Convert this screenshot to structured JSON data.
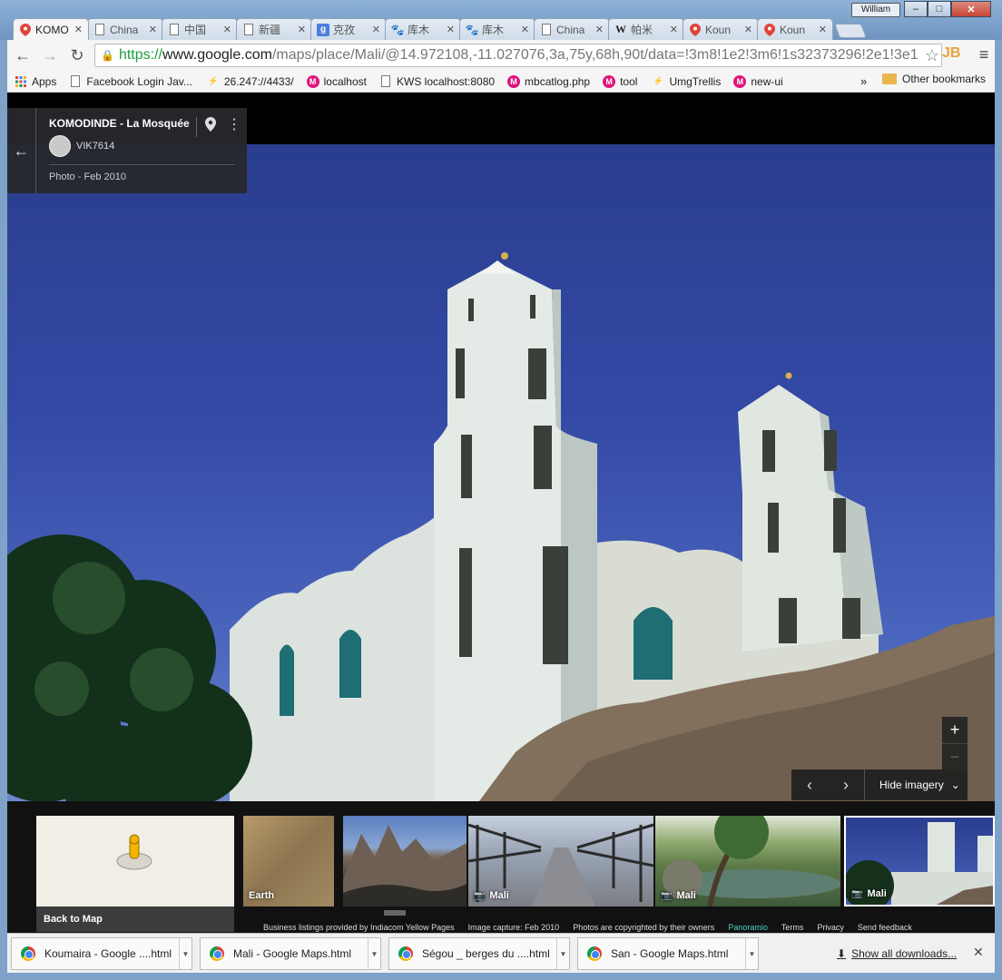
{
  "window": {
    "user": "William",
    "minimize": "–",
    "maximize": "□",
    "close": "✕"
  },
  "tabs": [
    {
      "label": "KOMO",
      "icon": "maps-icon",
      "active": true
    },
    {
      "label": "China",
      "icon": "page-icon"
    },
    {
      "label": "中国",
      "icon": "page-icon"
    },
    {
      "label": "新疆",
      "icon": "page-icon"
    },
    {
      "label": "克孜",
      "icon": "google-icon"
    },
    {
      "label": "库木",
      "icon": "baidu-icon"
    },
    {
      "label": "库木",
      "icon": "baidu-icon"
    },
    {
      "label": "China",
      "icon": "page-icon"
    },
    {
      "label": "帕米",
      "icon": "wikipedia-icon"
    },
    {
      "label": "Koun",
      "icon": "maps-icon"
    },
    {
      "label": "Koun",
      "icon": "maps-icon"
    }
  ],
  "toolbar": {
    "back": "←",
    "forward": "→",
    "reload": "↻",
    "url_scheme": "https://",
    "url_host": "www.google.com",
    "url_path": "/maps/place/Mali/@14.972108,-11.027076,3a,75y,68h,90t/data=!3m8!1e2!3m6!1s32373296!2e1!3e1",
    "extension": "JB"
  },
  "bookmarks": [
    {
      "label": "Apps",
      "icon": "apps-icon"
    },
    {
      "label": "Facebook Login Jav...",
      "icon": "page-icon"
    },
    {
      "label": "26.247://4433/",
      "icon": "link-icon"
    },
    {
      "label": "localhost",
      "icon": "m-icon"
    },
    {
      "label": "KWS localhost:8080",
      "icon": "page-icon"
    },
    {
      "label": "mbcatlog.php",
      "icon": "m-icon"
    },
    {
      "label": "tool",
      "icon": "m-icon"
    },
    {
      "label": "UmgTrellis",
      "icon": "link-icon"
    },
    {
      "label": "new-ui",
      "icon": "m-icon"
    }
  ],
  "bookmarks_more": "»",
  "bookmarks_other": "Other bookmarks",
  "place": {
    "title": "KOMODINDE - La Mosquée",
    "author": "VIK7614",
    "date": "Photo - Feb 2010"
  },
  "controls": {
    "zoom_in": "+",
    "zoom_out": "−",
    "prev": "‹",
    "next": "›",
    "hide_imagery": "Hide imagery"
  },
  "filmstrip": {
    "back_to_map": "Back to Map",
    "thumbs": [
      {
        "label": "Earth",
        "camera": false
      },
      {
        "label": "",
        "camera": false
      },
      {
        "label": "Mali",
        "camera": true
      },
      {
        "label": "Mali",
        "camera": true
      },
      {
        "label": "Mali",
        "camera": true
      }
    ],
    "attribution": [
      "Business listings provided by Indiacom Yellow Pages",
      "Image capture: Feb 2010",
      "Photos are copyrighted by their owners",
      "Panoramio",
      "Terms",
      "Privacy",
      "Send feedback"
    ]
  },
  "downloads": {
    "items": [
      "Koumaira - Google ....html",
      "Mali - Google Maps.html",
      "Ségou _ berges du ....html",
      "San - Google Maps.html"
    ],
    "show_all": "Show all downloads...",
    "close": "✕"
  }
}
